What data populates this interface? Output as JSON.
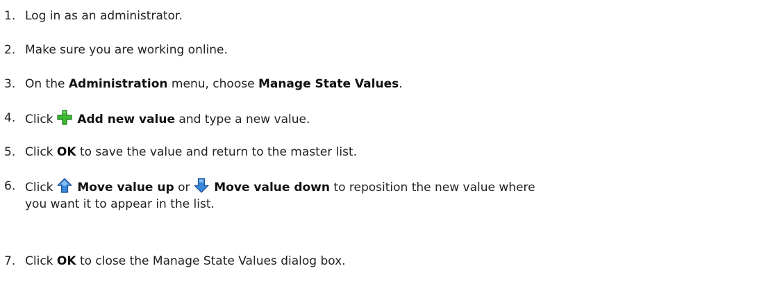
{
  "steps": [
    {
      "number": "1.",
      "text": "Log in as an administrator."
    },
    {
      "number": "2.",
      "text": "Make sure you are working online."
    },
    {
      "number": "3.",
      "pre": "On the ",
      "bold1": "Administration",
      "mid": " menu, choose ",
      "bold2": "Manage State Values",
      "post": "."
    },
    {
      "number": "4.",
      "pre": "Click ",
      "icon": "green-plus-icon",
      "bold1": "Add new value",
      "post": " and type a new value."
    },
    {
      "number": "5.",
      "pre": "Click ",
      "bold1": "OK",
      "post": " to save the value and return to the master list."
    },
    {
      "number": "6.",
      "pre": "Click ",
      "icon1": "blue-up-arrow-icon",
      "bold1": "Move value up",
      "mid": " or ",
      "icon2": "blue-down-arrow-icon",
      "bold2": "Move value down",
      "post": " to reposition the new value where",
      "line2": "you want it to appear in the list."
    },
    {
      "number": "7.",
      "pre": "Click ",
      "bold1": "OK",
      "post": " to close the Manage State Values dialog box."
    }
  ],
  "colors": {
    "text": "#222222",
    "plus_icon": "#3cb832",
    "arrow_icon": "#3a86d8"
  }
}
